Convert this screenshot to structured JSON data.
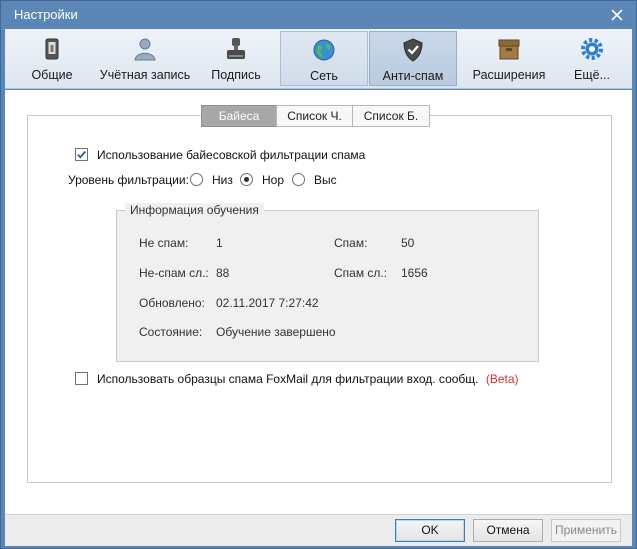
{
  "window": {
    "title": "Настройки"
  },
  "toolbar": {
    "items": [
      {
        "label": "Общие",
        "icon": "general-icon"
      },
      {
        "label": "Учётная запись",
        "icon": "account-icon"
      },
      {
        "label": "Подпись",
        "icon": "signature-icon"
      },
      {
        "label": "Сеть",
        "icon": "network-icon"
      },
      {
        "label": "Анти-спам",
        "icon": "antispam-icon",
        "selected": true
      },
      {
        "label": "Расширения",
        "icon": "extensions-icon"
      },
      {
        "label": "Ещё...",
        "icon": "more-gear-icon"
      }
    ]
  },
  "subtabs": [
    {
      "label": "Байеса",
      "active": true
    },
    {
      "label": "Список Ч."
    },
    {
      "label": "Список Б."
    }
  ],
  "bayes": {
    "enable_label": "Использование байесовской фильтрации спама",
    "enable_checked": true,
    "level_label": "Уровень фильтрации:",
    "levels": [
      {
        "label": "Низ",
        "selected": false
      },
      {
        "label": "Нор",
        "selected": true
      },
      {
        "label": "Выс",
        "selected": false
      }
    ]
  },
  "training": {
    "title": "Информация обучения",
    "not_spam_label": "Не спам:",
    "not_spam_value": "1",
    "spam_label": "Спам:",
    "spam_value": "50",
    "not_spam_words_label": "Не-спам сл.:",
    "not_spam_words_value": "88",
    "spam_words_label": "Спам сл.:",
    "spam_words_value": "1656",
    "updated_label": "Обновлено:",
    "updated_value": "02.11.2017 7:27:42",
    "status_label": "Состояние:",
    "status_value": "Обучение завершено"
  },
  "foxmail_samples": {
    "label": "Использовать образцы спама FoxMail для фильтрации вход. сообщ.",
    "checked": false,
    "beta": "(Beta)"
  },
  "buttons": {
    "ok": "OK",
    "cancel": "Отмена",
    "apply": "Применить"
  },
  "colors": {
    "titlebar": "#5b86b5",
    "beta": "#d92f2f",
    "selected_tab": "#a7a7a7"
  }
}
